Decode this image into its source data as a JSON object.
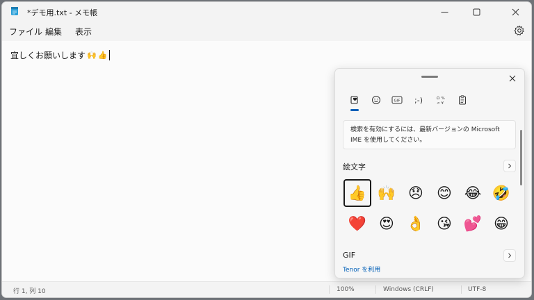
{
  "window": {
    "title": "*デモ用.txt - メモ帳"
  },
  "menu": {
    "items": [
      "ファイル",
      "編集",
      "表示"
    ]
  },
  "editor": {
    "text": "宜しくお願いします",
    "inline_emojis": [
      "🙌",
      "👍"
    ]
  },
  "status": {
    "position": "行 1, 列 10",
    "zoom": "100%",
    "line_ending": "Windows (CRLF)",
    "encoding": "UTF-8"
  },
  "emoji_panel": {
    "tabs": [
      {
        "name": "recent",
        "icon": "heart-clipboard-icon",
        "active": true
      },
      {
        "name": "emoji",
        "icon": "smiley-icon"
      },
      {
        "name": "gif",
        "icon": "gif-icon"
      },
      {
        "name": "kaomoji",
        "label": ";-)"
      },
      {
        "name": "symbols",
        "icon": "symbols-icon"
      },
      {
        "name": "clipboard",
        "icon": "clipboard-icon"
      }
    ],
    "ime_notice_line1": "検索を有効にするには、最新バージョンの Microsoft",
    "ime_notice_line2": "IME を使用してください。",
    "emoji_section_title": "絵文字",
    "emojis": [
      "👍",
      "🙌",
      "😞",
      "😊",
      "😂",
      "🤣",
      "❤️",
      "😍",
      "👌",
      "😘",
      "💕",
      "😁"
    ],
    "gif_section_title": "GIF",
    "tenor_link": "Tenor を利用"
  },
  "colors": {
    "accent": "#005fb8",
    "window_bg": "#fafafa",
    "chrome_bg": "#f3f3f3"
  }
}
